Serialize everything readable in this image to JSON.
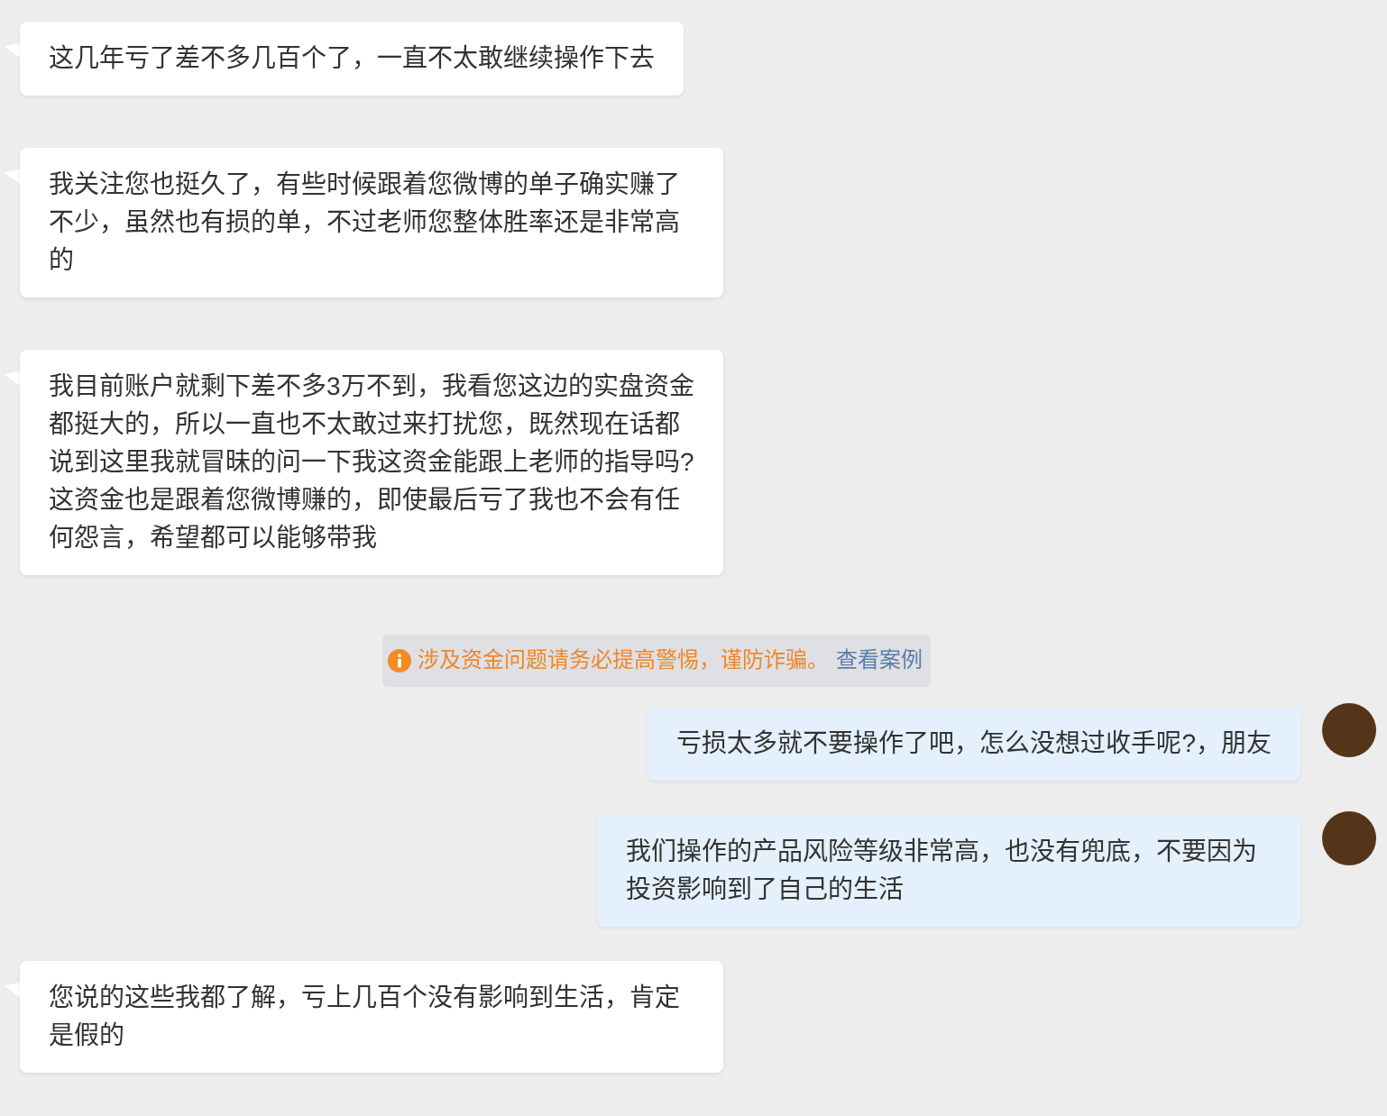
{
  "messages": [
    {
      "kind": "received",
      "text": "这几年亏了差不多几百个了，一直不太敢继续操作下去"
    },
    {
      "kind": "received",
      "text": "我关注您也挺久了，有些时候跟着您微博的单子确实赚了不少，虽然也有损的单，不过老师您整体胜率还是非常高的"
    },
    {
      "kind": "received",
      "text": "我目前账户就剩下差不多3万不到，我看您这边的实盘资金都挺大的，所以一直也不太敢过来打扰您，既然现在话都说到这里我就冒昧的问一下我这资金能跟上老师的指导吗?这资金也是跟着您微博赚的，即使最后亏了我也不会有任何怨言，希望都可以能够带我"
    },
    {
      "kind": "notice",
      "text": "涉及资金问题请务必提高警惕，谨防诈骗。",
      "link": "查看案例"
    },
    {
      "kind": "sent",
      "text": "亏损太多就不要操作了吧，怎么没想过收手呢?，朋友"
    },
    {
      "kind": "sent",
      "text": "我们操作的产品风险等级非常高，也没有兜底，不要因为投资影响到了自己的生活"
    },
    {
      "kind": "received",
      "text": "您说的这些我都了解，亏上几百个没有影响到生活，肯定是假的"
    }
  ]
}
